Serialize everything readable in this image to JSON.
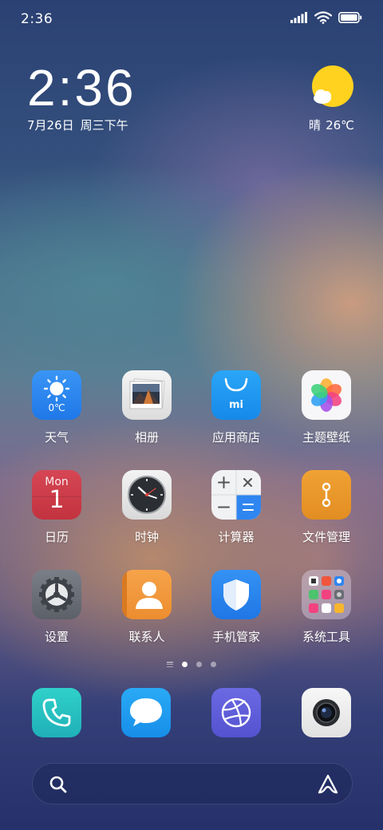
{
  "status_bar": {
    "time": "2:36",
    "icons": [
      "signal-icon",
      "wifi-icon",
      "battery-icon"
    ]
  },
  "clock_widget": {
    "time": "2:36",
    "date": "7月26日",
    "weekday": "周三下午"
  },
  "weather_widget": {
    "icon": "sun-cloud-icon",
    "condition": "晴",
    "temperature": "26℃"
  },
  "apps": [
    {
      "label": "天气",
      "icon": "weather-icon",
      "badge_text": "0℃"
    },
    {
      "label": "相册",
      "icon": "gallery-icon"
    },
    {
      "label": "应用商店",
      "icon": "app-store-icon",
      "badge_text": "mi"
    },
    {
      "label": "主题壁纸",
      "icon": "themes-icon"
    },
    {
      "label": "日历",
      "icon": "calendar-icon",
      "day_name": "Mon",
      "day_number": "1"
    },
    {
      "label": "时钟",
      "icon": "clock-icon"
    },
    {
      "label": "计算器",
      "icon": "calculator-icon"
    },
    {
      "label": "文件管理",
      "icon": "file-manager-icon"
    },
    {
      "label": "设置",
      "icon": "settings-icon"
    },
    {
      "label": "联系人",
      "icon": "contacts-icon"
    },
    {
      "label": "手机管家",
      "icon": "security-icon"
    },
    {
      "label": "系统工具",
      "icon": "system-tools-folder-icon"
    }
  ],
  "page_indicator": {
    "pages": 3,
    "active": 0
  },
  "dock": [
    {
      "name": "phone",
      "icon": "phone-icon"
    },
    {
      "name": "messages",
      "icon": "messages-icon"
    },
    {
      "name": "browser",
      "icon": "browser-icon"
    },
    {
      "name": "camera",
      "icon": "camera-icon"
    }
  ],
  "search_bar": {
    "icon": "search-icon",
    "assistant_icon": "assistant-icon"
  },
  "colors": {
    "sun": "#FFD21F",
    "weather_tile": "#2F86F0",
    "app_store_tile": "#1E9BF3",
    "calendar_tile": "#D0414D",
    "file_manager_tile": "#E89A2A",
    "contacts_tile": "#F09A3E",
    "security_tile": "#2F86F0"
  }
}
